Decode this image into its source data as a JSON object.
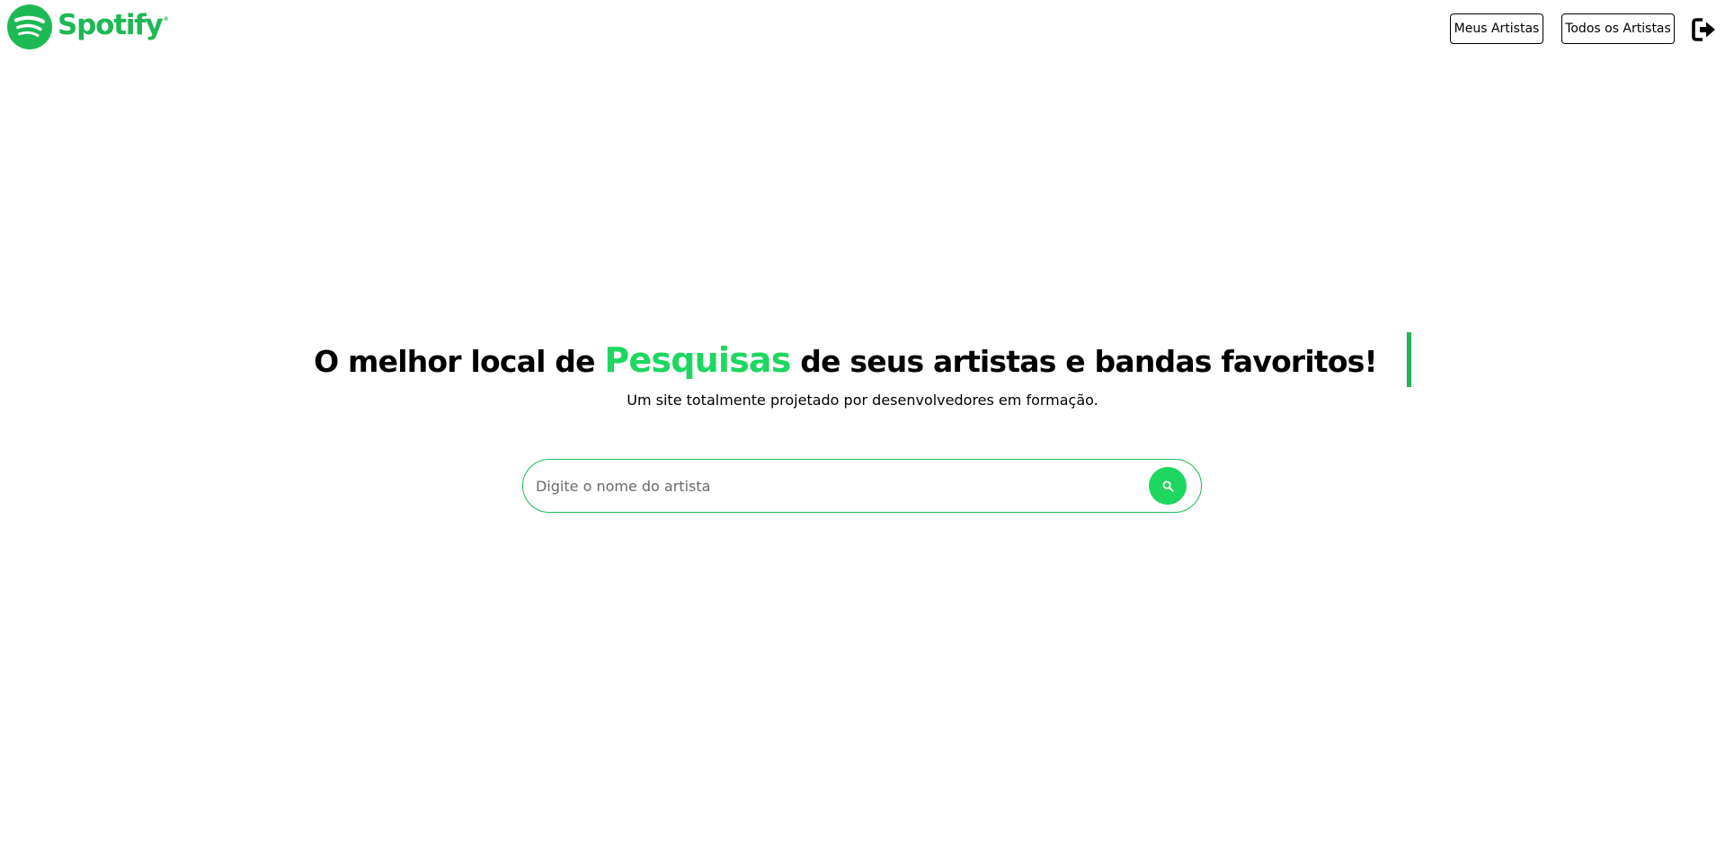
{
  "header": {
    "brand": "Spotify",
    "brand_mark": "®",
    "nav": [
      {
        "label": "Meus Artistas"
      },
      {
        "label": "Todos os Artistas"
      }
    ],
    "logout_icon": "sign-out-icon"
  },
  "hero": {
    "title_before": "O melhor local de ",
    "title_accent": "Pesquisas",
    "title_after": " de seus artistas e bandas favoritos!",
    "subtitle": "Um site totalmente projetado por desenvolvedores em formação."
  },
  "search": {
    "placeholder": "Digite o nome do artista",
    "value": "",
    "button_icon": "search-icon"
  },
  "colors": {
    "brand": "#1DB954",
    "accent": "#1ED760",
    "text": "#000000",
    "background": "#FFFFFF"
  }
}
